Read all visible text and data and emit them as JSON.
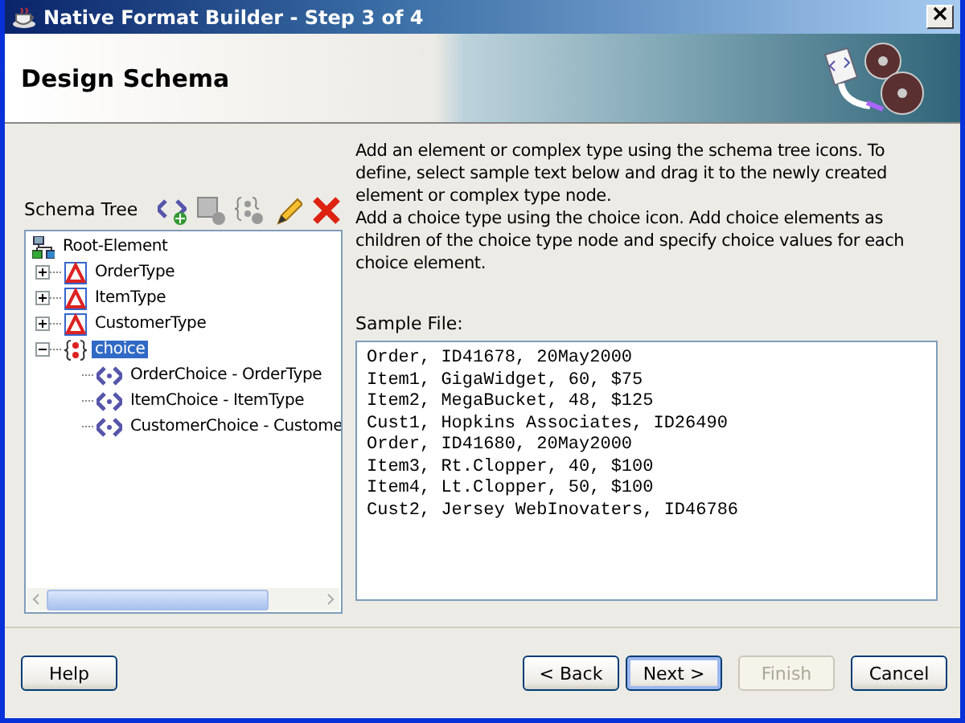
{
  "window": {
    "title": "Native Format Builder - Step 3 of 4"
  },
  "header": {
    "title": "Design Schema"
  },
  "schema_tree": {
    "label": "Schema Tree",
    "nodes": [
      {
        "label": "Root-Element",
        "kind": "root",
        "selected": false,
        "children": [
          {
            "label": "OrderType",
            "kind": "complex",
            "expanded": false,
            "selected": false
          },
          {
            "label": "ItemType",
            "kind": "complex",
            "expanded": false,
            "selected": false
          },
          {
            "label": "CustomerType",
            "kind": "complex",
            "expanded": false,
            "selected": false
          },
          {
            "label": "choice",
            "kind": "choice",
            "expanded": true,
            "selected": true,
            "children": [
              {
                "label": "OrderChoice - OrderType",
                "kind": "element",
                "selected": false
              },
              {
                "label": "ItemChoice - ItemType",
                "kind": "element",
                "selected": false
              },
              {
                "label": "CustomerChoice - Custome",
                "kind": "element",
                "selected": false
              }
            ]
          }
        ]
      }
    ]
  },
  "instructions": [
    "Add an element or complex type using the schema tree icons. To define, select sample text below and drag it to the newly created element or complex type node.",
    "Add a choice type using the choice icon. Add choice elements as children of the choice type node and specify choice values for each choice element."
  ],
  "sample_file": {
    "label": "Sample File:",
    "lines": [
      "Order, ID41678, 20May2000",
      "Item1, GigaWidget, 60, $75",
      "Item2, MegaBucket, 48, $125",
      "Cust1, Hopkins Associates, ID26490",
      "Order, ID41680, 20May2000",
      "Item3, Rt.Clopper, 40, $100",
      "Item4, Lt.Clopper, 50, $100",
      "Cust2, Jersey WebInovaters, ID46786"
    ]
  },
  "buttons": [
    {
      "label": "Help",
      "default": false,
      "disabled": false
    },
    {
      "label": "< Back",
      "default": false,
      "disabled": false
    },
    {
      "label": "Next >",
      "default": true,
      "disabled": false
    },
    {
      "label": "Finish",
      "default": false,
      "disabled": true
    },
    {
      "label": "Cancel",
      "default": false,
      "disabled": false
    }
  ]
}
